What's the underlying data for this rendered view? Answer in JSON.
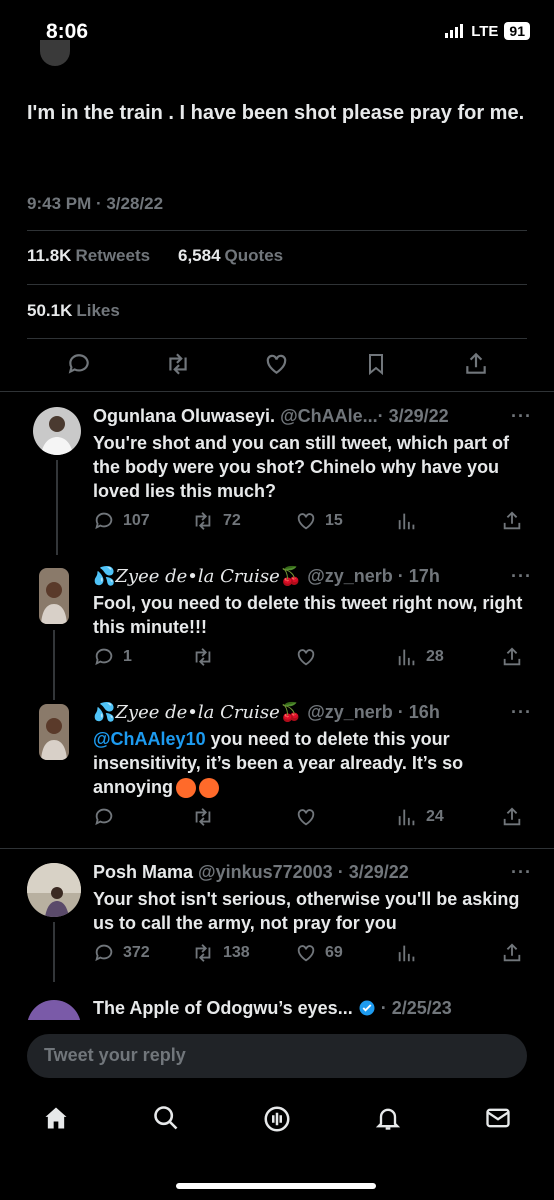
{
  "status": {
    "time": "8:06",
    "network": "LTE",
    "battery": "91"
  },
  "tweet": {
    "text": "I'm in the train .  I have been shot please pray for me.",
    "timestamp": "9:43 PM · 3/28/22",
    "retweets_count": "11.8K",
    "retweets_label": "Retweets",
    "quotes_count": "6,584",
    "quotes_label": "Quotes",
    "likes_count": "50.1K",
    "likes_label": "Likes"
  },
  "replies": [
    {
      "name": "Ogunlana Oluwaseyi.",
      "handle": "@ChAAle...",
      "time": "· 3/29/22",
      "text": "You're shot and you can still tweet, which part of the body were you shot? Chinelo why have you loved lies this much?",
      "reply_count": "107",
      "retweet_count": "72",
      "like_count": "15",
      "views": ""
    },
    {
      "name_prefix": "💦",
      "name": "Zyee de•la Cruise",
      "name_suffix": "🍒",
      "handle": "@zy_nerb",
      "time": "· 17h",
      "text": "Fool, you need to delete this tweet right now, right this minute!!!",
      "reply_count": "1",
      "retweet_count": "",
      "like_count": "",
      "views": "28"
    },
    {
      "name_prefix": "💦",
      "name": "Zyee de•la Cruise",
      "name_suffix": "🍒",
      "handle": "@zy_nerb",
      "time": "· 16h",
      "mention": "@ChAAley10",
      "text": " you need to delete this your insensitivity, it’s been a year already. It’s so annoying",
      "reply_count": "",
      "retweet_count": "",
      "like_count": "",
      "views": "24"
    },
    {
      "name": "Posh Mama",
      "handle": "@yinkus772003",
      "time": "· 3/29/22",
      "text": "Your shot isn't serious, otherwise you'll be asking us to call the army, not pray for you",
      "reply_count": "372",
      "retweet_count": "138",
      "like_count": "69",
      "views": ""
    },
    {
      "name": "The Apple of Odogwu’s eyes...",
      "time": "· 2/25/23"
    }
  ],
  "more_label": "···",
  "reply_box": {
    "placeholder": "Tweet your reply"
  },
  "colors": {
    "background": "#000000",
    "text": "#e7e9ea",
    "muted": "#71767b",
    "accent": "#1d9bf0",
    "divider": "#2f3336"
  },
  "icons": [
    "reply-icon",
    "retweet-icon",
    "like-icon",
    "bookmark-icon",
    "share-icon",
    "views-icon",
    "home-icon",
    "search-icon",
    "spaces-icon",
    "notifications-icon",
    "messages-icon",
    "verified-badge-icon"
  ]
}
